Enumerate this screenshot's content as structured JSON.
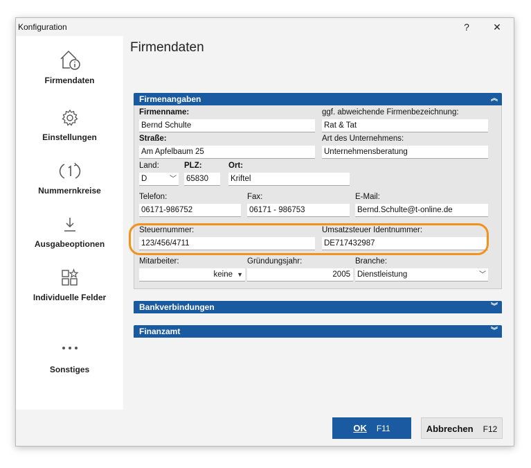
{
  "window": {
    "title": "Konfiguration",
    "help_label": "?",
    "close_label": "✕"
  },
  "sidebar": {
    "items": [
      {
        "label": "Firmendaten",
        "icon": "house-info-icon"
      },
      {
        "label": "Einstellungen",
        "icon": "gear-icon"
      },
      {
        "label": "Nummernkreise",
        "icon": "counter-icon"
      },
      {
        "label": "Ausgabeoptionen",
        "icon": "download-icon"
      },
      {
        "label": "Individuelle Felder",
        "icon": "grid-star-icon"
      },
      {
        "label": "Sonstiges",
        "icon": "more-dots-icon"
      }
    ]
  },
  "main": {
    "title": "Firmendaten",
    "panels": {
      "firmenangaben": {
        "label": "Firmenangaben",
        "state": "expanded"
      },
      "bankverbindungen": {
        "label": "Bankverbindungen",
        "state": "collapsed"
      },
      "finanzamt": {
        "label": "Finanzamt",
        "state": "collapsed"
      }
    },
    "form": {
      "firmenname": {
        "label": "Firmenname:",
        "value": "Bernd Schulte"
      },
      "abweichend": {
        "label": "ggf. abweichende Firmenbezeichnung:",
        "value": "Rat & Tat"
      },
      "strasse": {
        "label": "Straße:",
        "value": "Am Apfelbaum 25"
      },
      "art": {
        "label": "Art des Unternehmens:",
        "value": "Unternehmensberatung"
      },
      "land": {
        "label": "Land:",
        "value": "D"
      },
      "plz": {
        "label": "PLZ:",
        "value": "65830"
      },
      "ort": {
        "label": "Ort:",
        "value": "Kriftel"
      },
      "telefon": {
        "label": "Telefon:",
        "value": "06171-986752"
      },
      "fax": {
        "label": "Fax:",
        "value": "06171 - 986753"
      },
      "email": {
        "label": "E-Mail:",
        "value": "Bernd.Schulte@t-online.de"
      },
      "steuernummer": {
        "label": "Steuernummer:",
        "value": "123/456/4711"
      },
      "ustid": {
        "label": "Umsatzsteuer Identnummer:",
        "value": "DE717432987"
      },
      "mitarbeiter": {
        "label": "Mitarbeiter:",
        "value": "keine"
      },
      "gruendungsjahr": {
        "label": "Gründungsjahr:",
        "value": "2005"
      },
      "branche": {
        "label": "Branche:",
        "value": "Dienstleistung"
      }
    }
  },
  "footer": {
    "ok": {
      "label": "OK",
      "key": "F11"
    },
    "cancel": {
      "label": "Abbrechen",
      "key": "F12"
    }
  },
  "colors": {
    "accent": "#1a5aa0",
    "highlight": "#f0921c"
  }
}
